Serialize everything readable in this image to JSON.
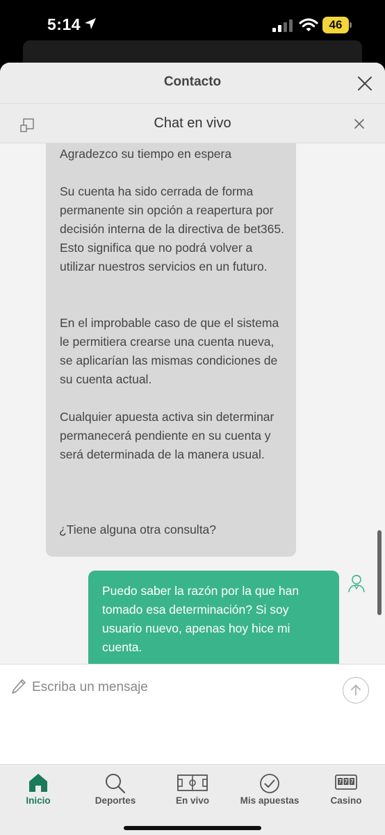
{
  "status_bar": {
    "time": "5:14",
    "battery": "46",
    "icons": [
      "location-arrow-icon",
      "signal-icon",
      "wifi-icon",
      "battery-icon"
    ]
  },
  "sheet": {
    "title": "Contacto"
  },
  "chat": {
    "title": "Chat en vivo",
    "messages": [
      {
        "from": "agent",
        "paragraphs": [
          "Agradezco su tiempo en espera",
          "Su cuenta ha sido cerrada de forma permanente sin opción a reapertura por decisión interna de la directiva de bet365. Esto significa que no podrá volver a utilizar nuestros servicios en un futuro.",
          "En el improbable caso de que el sistema le permitiera crearse una cuenta nueva, se aplicarían las mismas condiciones de su cuenta actual.",
          "Cualquier apuesta activa sin determinar permanecerá pendiente en su cuenta y será determinada de la manera usual."
        ]
      },
      {
        "from": "agent",
        "text": "¿Tiene alguna otra consulta?"
      },
      {
        "from": "user",
        "text": "Puedo saber la razón por la que han tomado esa determinación? Si soy usuario nuevo, apenas hoy hice mi cuenta."
      }
    ]
  },
  "composer": {
    "placeholder": "Escriba un mensaje"
  },
  "tabs": [
    {
      "label": "Inicio",
      "icon": "home-icon",
      "active": true
    },
    {
      "label": "Deportes",
      "icon": "search-icon",
      "active": false
    },
    {
      "label": "En vivo",
      "icon": "field-icon",
      "active": false
    },
    {
      "label": "Mis apuestas",
      "icon": "check-circle-icon",
      "active": false
    },
    {
      "label": "Casino",
      "icon": "slot-machine-icon",
      "active": false
    }
  ],
  "colors": {
    "accent": "#1a7a5a",
    "user_bubble": "#3ab48a",
    "agent_bubble": "#d8d8d8",
    "battery": "#f5d63a"
  }
}
